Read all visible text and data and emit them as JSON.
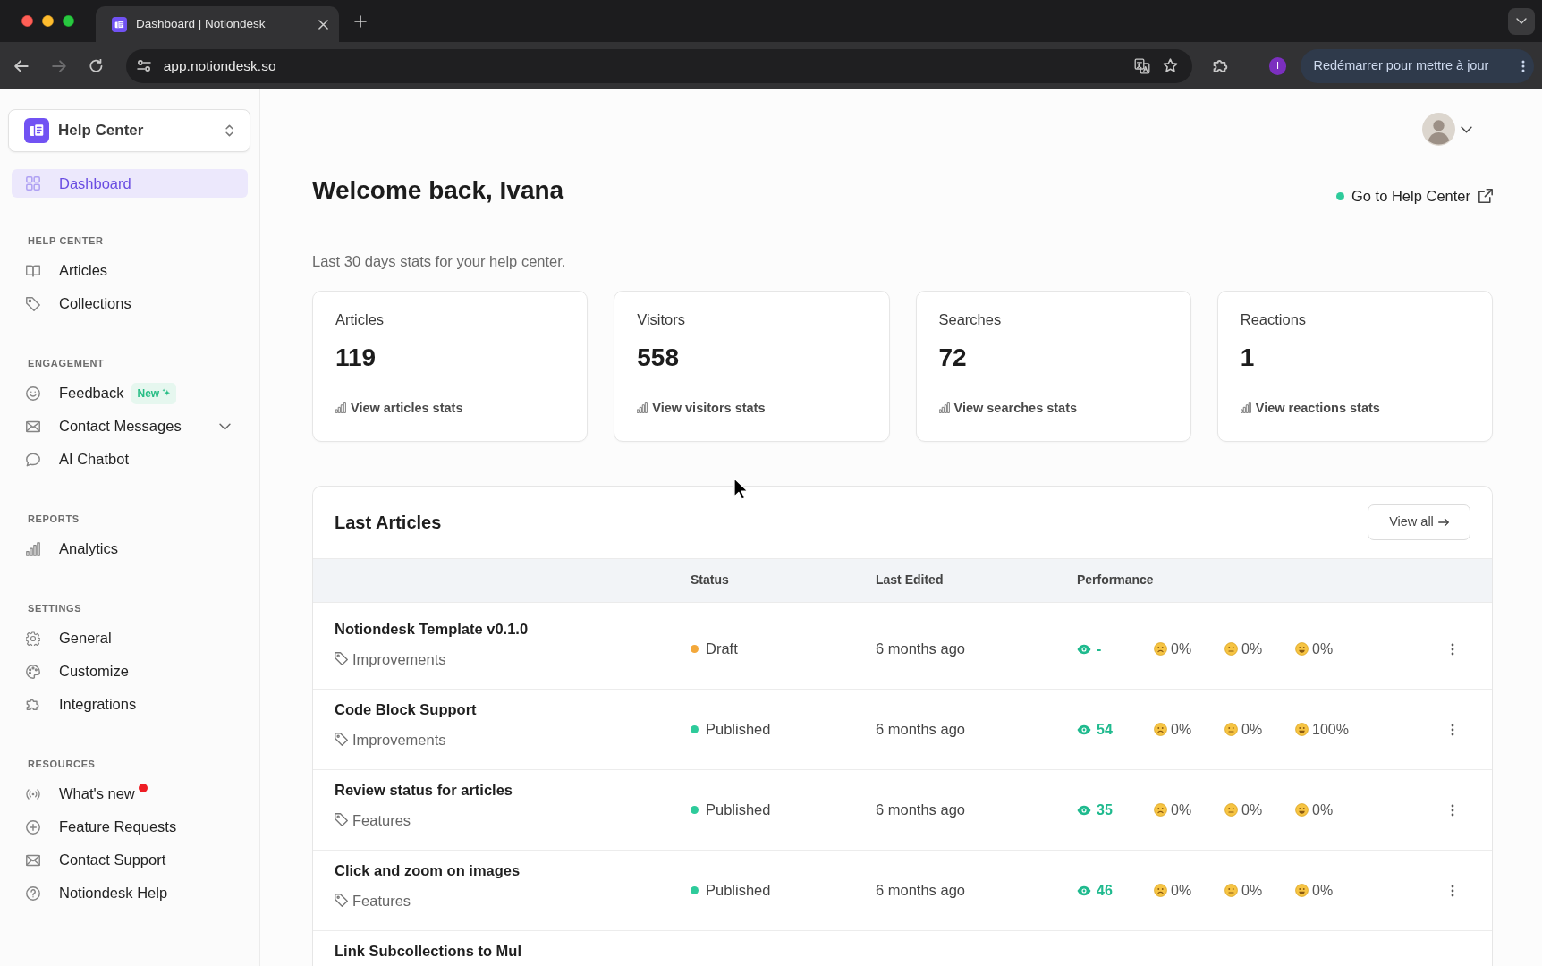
{
  "browser": {
    "tab_title": "Dashboard | Notiondesk",
    "forward_disabled": true,
    "address": "app.notiondesk.so",
    "profile_initial": "I",
    "update_button": "Redémarrer pour mettre à jour"
  },
  "sidebar": {
    "workspace": "Help Center",
    "top_items": [
      {
        "label": "Dashboard",
        "selected": true
      }
    ],
    "sections": [
      {
        "heading": "HELP CENTER",
        "items": [
          {
            "label": "Articles",
            "selected": false
          },
          {
            "label": "Collections",
            "selected": false
          }
        ]
      },
      {
        "heading": "ENGAGEMENT",
        "items": [
          {
            "label": "Feedback",
            "selected": false,
            "badge": "New"
          },
          {
            "label": "Contact Messages",
            "selected": false,
            "expanded": false
          },
          {
            "label": "AI Chatbot",
            "selected": false
          }
        ]
      },
      {
        "heading": "REPORTS",
        "items": [
          {
            "label": "Analytics",
            "selected": false
          }
        ]
      },
      {
        "heading": "SETTINGS",
        "items": [
          {
            "label": "General",
            "selected": false
          },
          {
            "label": "Customize",
            "selected": false
          },
          {
            "label": "Integrations",
            "selected": false
          }
        ]
      },
      {
        "heading": "RESOURCES",
        "items": [
          {
            "label": "What's new",
            "selected": false,
            "unread": true
          },
          {
            "label": "Feature Requests",
            "selected": false
          },
          {
            "label": "Contact Support",
            "selected": false
          },
          {
            "label": "Notiondesk Help",
            "selected": false
          }
        ]
      }
    ]
  },
  "header": {
    "title": "Welcome back, Ivana",
    "help_center_link": {
      "label": "Go to Help Center",
      "online": true
    },
    "subtitle": "Last 30 days stats for your help center."
  },
  "stats": [
    {
      "label": "Articles",
      "value": "119",
      "link": "View articles stats"
    },
    {
      "label": "Visitors",
      "value": "558",
      "link": "View visitors stats"
    },
    {
      "label": "Searches",
      "value": "72",
      "link": "View searches stats"
    },
    {
      "label": "Reactions",
      "value": "1",
      "link": "View reactions stats"
    }
  ],
  "last_articles": {
    "title": "Last Articles",
    "view_all": "View all",
    "columns": [
      "Status",
      "Last Edited",
      "Performance"
    ],
    "rows": [
      {
        "title": "Notiondesk Template v0.1.0",
        "tag": "Improvements",
        "status": {
          "label": "Draft",
          "color": "#f3a83b"
        },
        "edited": "6 months ago",
        "views": "-",
        "reactions": [
          "0%",
          "0%",
          "0%"
        ]
      },
      {
        "title": "Code Block Support",
        "tag": "Improvements",
        "status": {
          "label": "Published",
          "color": "#2ecb9b"
        },
        "edited": "6 months ago",
        "views": "54",
        "reactions": [
          "0%",
          "0%",
          "100%"
        ]
      },
      {
        "title": "Review status for articles",
        "tag": "Features",
        "status": {
          "label": "Published",
          "color": "#2ecb9b"
        },
        "edited": "6 months ago",
        "views": "35",
        "reactions": [
          "0%",
          "0%",
          "0%"
        ]
      },
      {
        "title": "Click and zoom on images",
        "tag": "Features",
        "status": {
          "label": "Published",
          "color": "#2ecb9b"
        },
        "edited": "6 months ago",
        "views": "46",
        "reactions": [
          "0%",
          "0%",
          "0%"
        ]
      },
      {
        "title": "Link Subcollections to Mul"
      }
    ]
  }
}
